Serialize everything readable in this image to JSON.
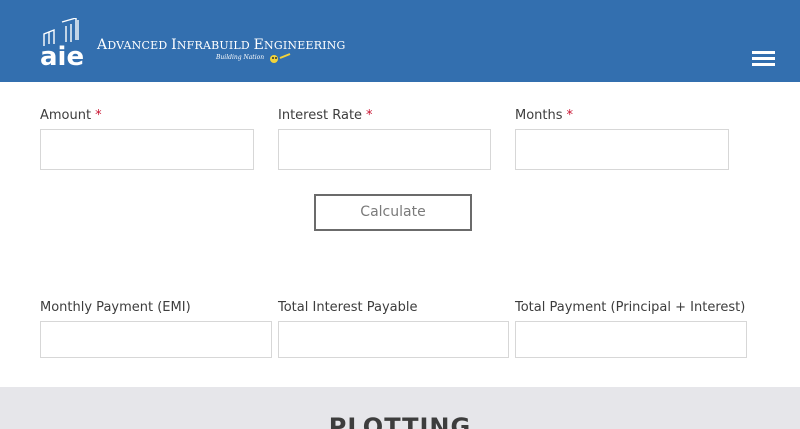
{
  "header": {
    "logo_letters": "aie",
    "brand_first_initials": [
      "A",
      "I",
      "E"
    ],
    "brand_words_rest": [
      "DVANCED",
      "NFRABUILD",
      "NGINEERING"
    ],
    "brand_name": "Advanced Infrabuild Engineering",
    "tagline": "Building Nation",
    "background_color": "#336faf",
    "menu_icon": "hamburger-icon"
  },
  "inputs": {
    "amount": {
      "label": "Amount",
      "required_mark": "*",
      "value": ""
    },
    "interest_rate": {
      "label": "Interest Rate",
      "required_mark": "*",
      "value": ""
    },
    "months": {
      "label": "Months",
      "required_mark": "*",
      "value": ""
    }
  },
  "calculate_button": {
    "label": "Calculate"
  },
  "results": {
    "emi": {
      "label": "Monthly Payment (EMI)",
      "value": ""
    },
    "total_interest": {
      "label": "Total Interest Payable",
      "value": ""
    },
    "total_payment": {
      "label": "Total Payment (Principal + Interest)",
      "value": ""
    }
  },
  "plotting": {
    "title": "PLOTTING",
    "background_color": "#e6e6ea"
  },
  "colors": {
    "required": "#c8102e",
    "text": "#3d3d3d",
    "input_border": "#d7d7d7"
  }
}
